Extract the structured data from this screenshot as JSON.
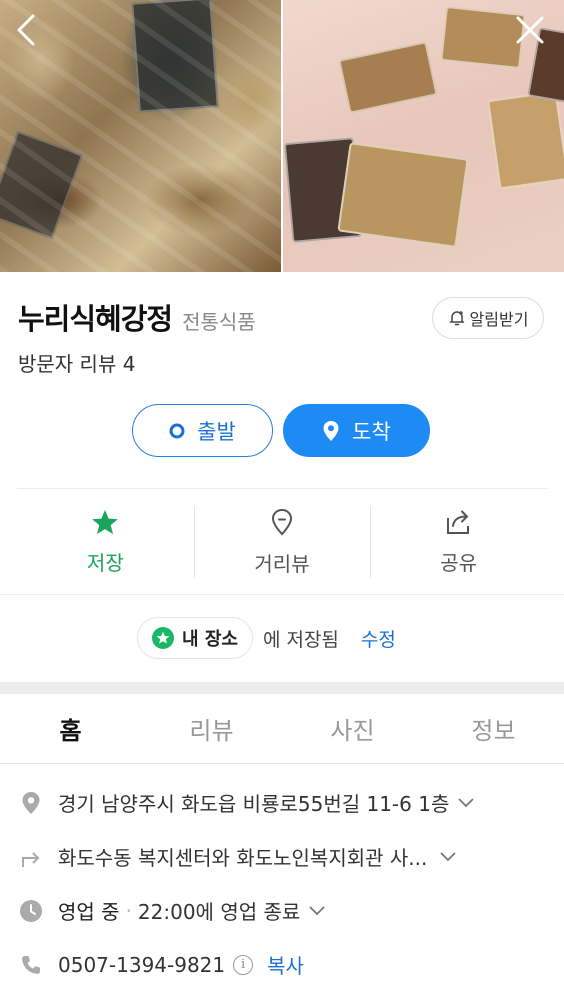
{
  "place": {
    "name": "누리식혜강정",
    "category": "전통식품",
    "review_text": "방문자 리뷰 4"
  },
  "alert_button": {
    "label": "알림받기"
  },
  "route": {
    "depart_label": "출발",
    "arrive_label": "도착"
  },
  "actions": {
    "save_label": "저장",
    "streetview_label": "거리뷰",
    "share_label": "공유"
  },
  "saved": {
    "chip_label": "내 장소",
    "text": "에 저장됨",
    "edit_label": "수정"
  },
  "tabs": [
    {
      "label": "홈",
      "active": true
    },
    {
      "label": "리뷰"
    },
    {
      "label": "사진"
    },
    {
      "label": "정보"
    }
  ],
  "info": {
    "address": "경기 남양주시 화도읍 비룡로55번길 11-6 1층",
    "directions": "화도수동 복지센터와 화도노인복지회관 사...",
    "status": "영업 중",
    "hours": "22:00에 영업 종료",
    "phone": "0507-1394-9821",
    "copy_label": "복사"
  },
  "colors": {
    "primary_blue": "#1e8bf5",
    "save_green": "#1aa35a",
    "link_blue": "#1a6fd4"
  }
}
